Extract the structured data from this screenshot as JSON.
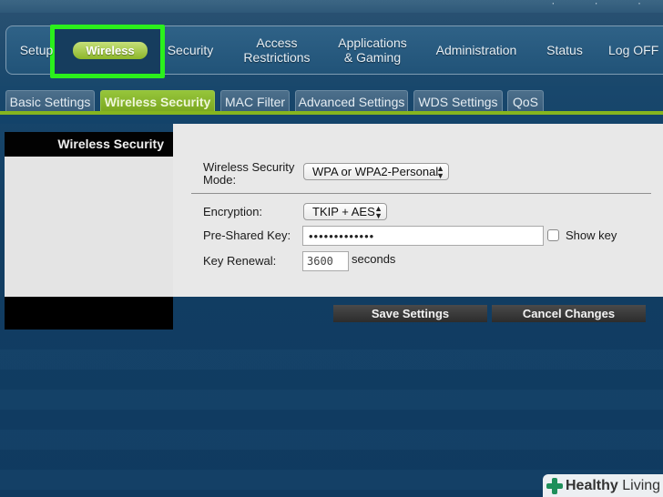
{
  "nav": {
    "items": [
      {
        "id": "setup",
        "label": "Setup"
      },
      {
        "id": "wireless",
        "label": "Wireless"
      },
      {
        "id": "security",
        "label": "Security"
      },
      {
        "id": "access",
        "label": "Access\nRestrictions"
      },
      {
        "id": "apps",
        "label": "Applications\n& Gaming"
      },
      {
        "id": "admin",
        "label": "Administration"
      },
      {
        "id": "status",
        "label": "Status"
      },
      {
        "id": "logoff",
        "label": "Log OFF"
      }
    ],
    "active": "Wireless",
    "highlight_color": "#2bf01c"
  },
  "subtabs": {
    "items": [
      {
        "label": "Basic Settings"
      },
      {
        "label": "Wireless Security"
      },
      {
        "label": "MAC Filter"
      },
      {
        "label": "Advanced Settings"
      },
      {
        "label": "WDS Settings"
      },
      {
        "label": "QoS"
      }
    ],
    "active": "Wireless Security",
    "accent_color": "#86b51f"
  },
  "side_panel": {
    "title": "Wireless Security"
  },
  "form": {
    "security_mode_label": "Wireless Security\nMode:",
    "security_mode_value": "WPA or WPA2-Personal",
    "encryption_label": "Encryption:",
    "encryption_value": "TKIP + AES",
    "psk_label": "Pre-Shared Key:",
    "psk_value": "•••••••••••••",
    "show_key_label": "Show key",
    "renewal_label": "Key Renewal:",
    "renewal_value": "3600",
    "renewal_unit": "seconds"
  },
  "actions": {
    "save": "Save Settings",
    "cancel": "Cancel Changes"
  },
  "watermark": {
    "brand_bold": "Healthy",
    "brand_rest": "Living"
  }
}
